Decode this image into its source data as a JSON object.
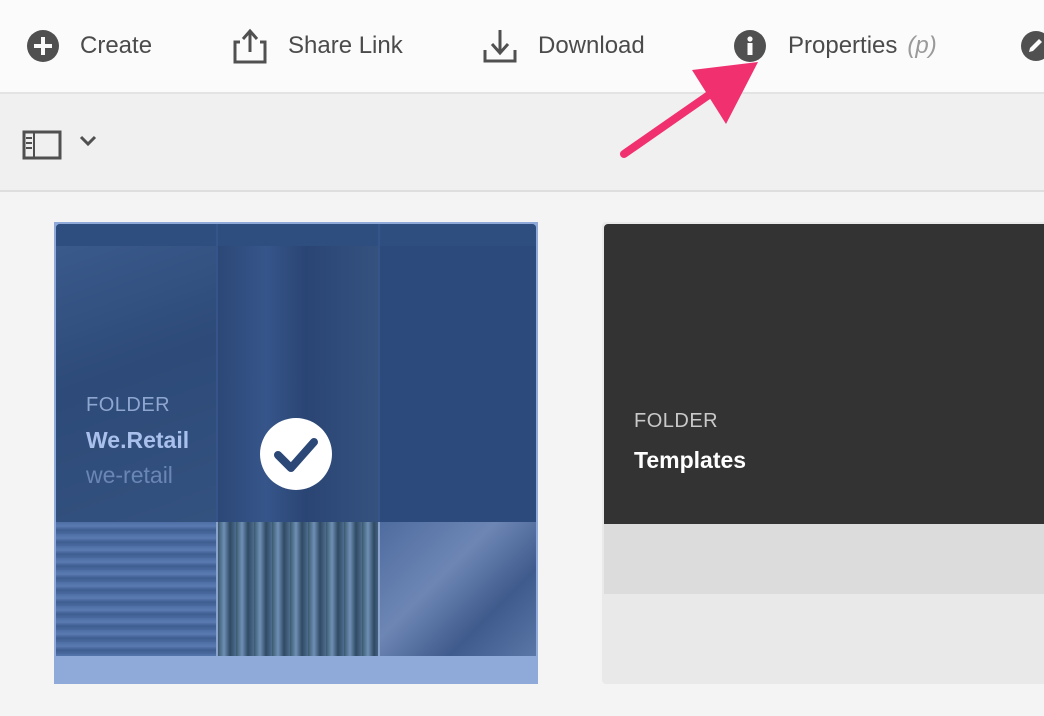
{
  "actions": {
    "create": "Create",
    "share_link": "Share Link",
    "download": "Download",
    "properties": "Properties",
    "properties_shortcut": "(p)"
  },
  "toolbar": {
    "rail_icon": "rail-toggle-icon",
    "view_icon": "chevron-down-icon"
  },
  "cards": [
    {
      "type_label": "FOLDER",
      "title": "We.Retail",
      "subtitle": "we-retail",
      "selected": true
    },
    {
      "type_label": "FOLDER",
      "title": "Templates",
      "selected": false
    }
  ],
  "annotation": {
    "arrow_color": "#f0306f"
  },
  "colors": {
    "selection": "#2b4877",
    "selection_border": "#8fa9d8",
    "folder_dark": "#333333"
  }
}
